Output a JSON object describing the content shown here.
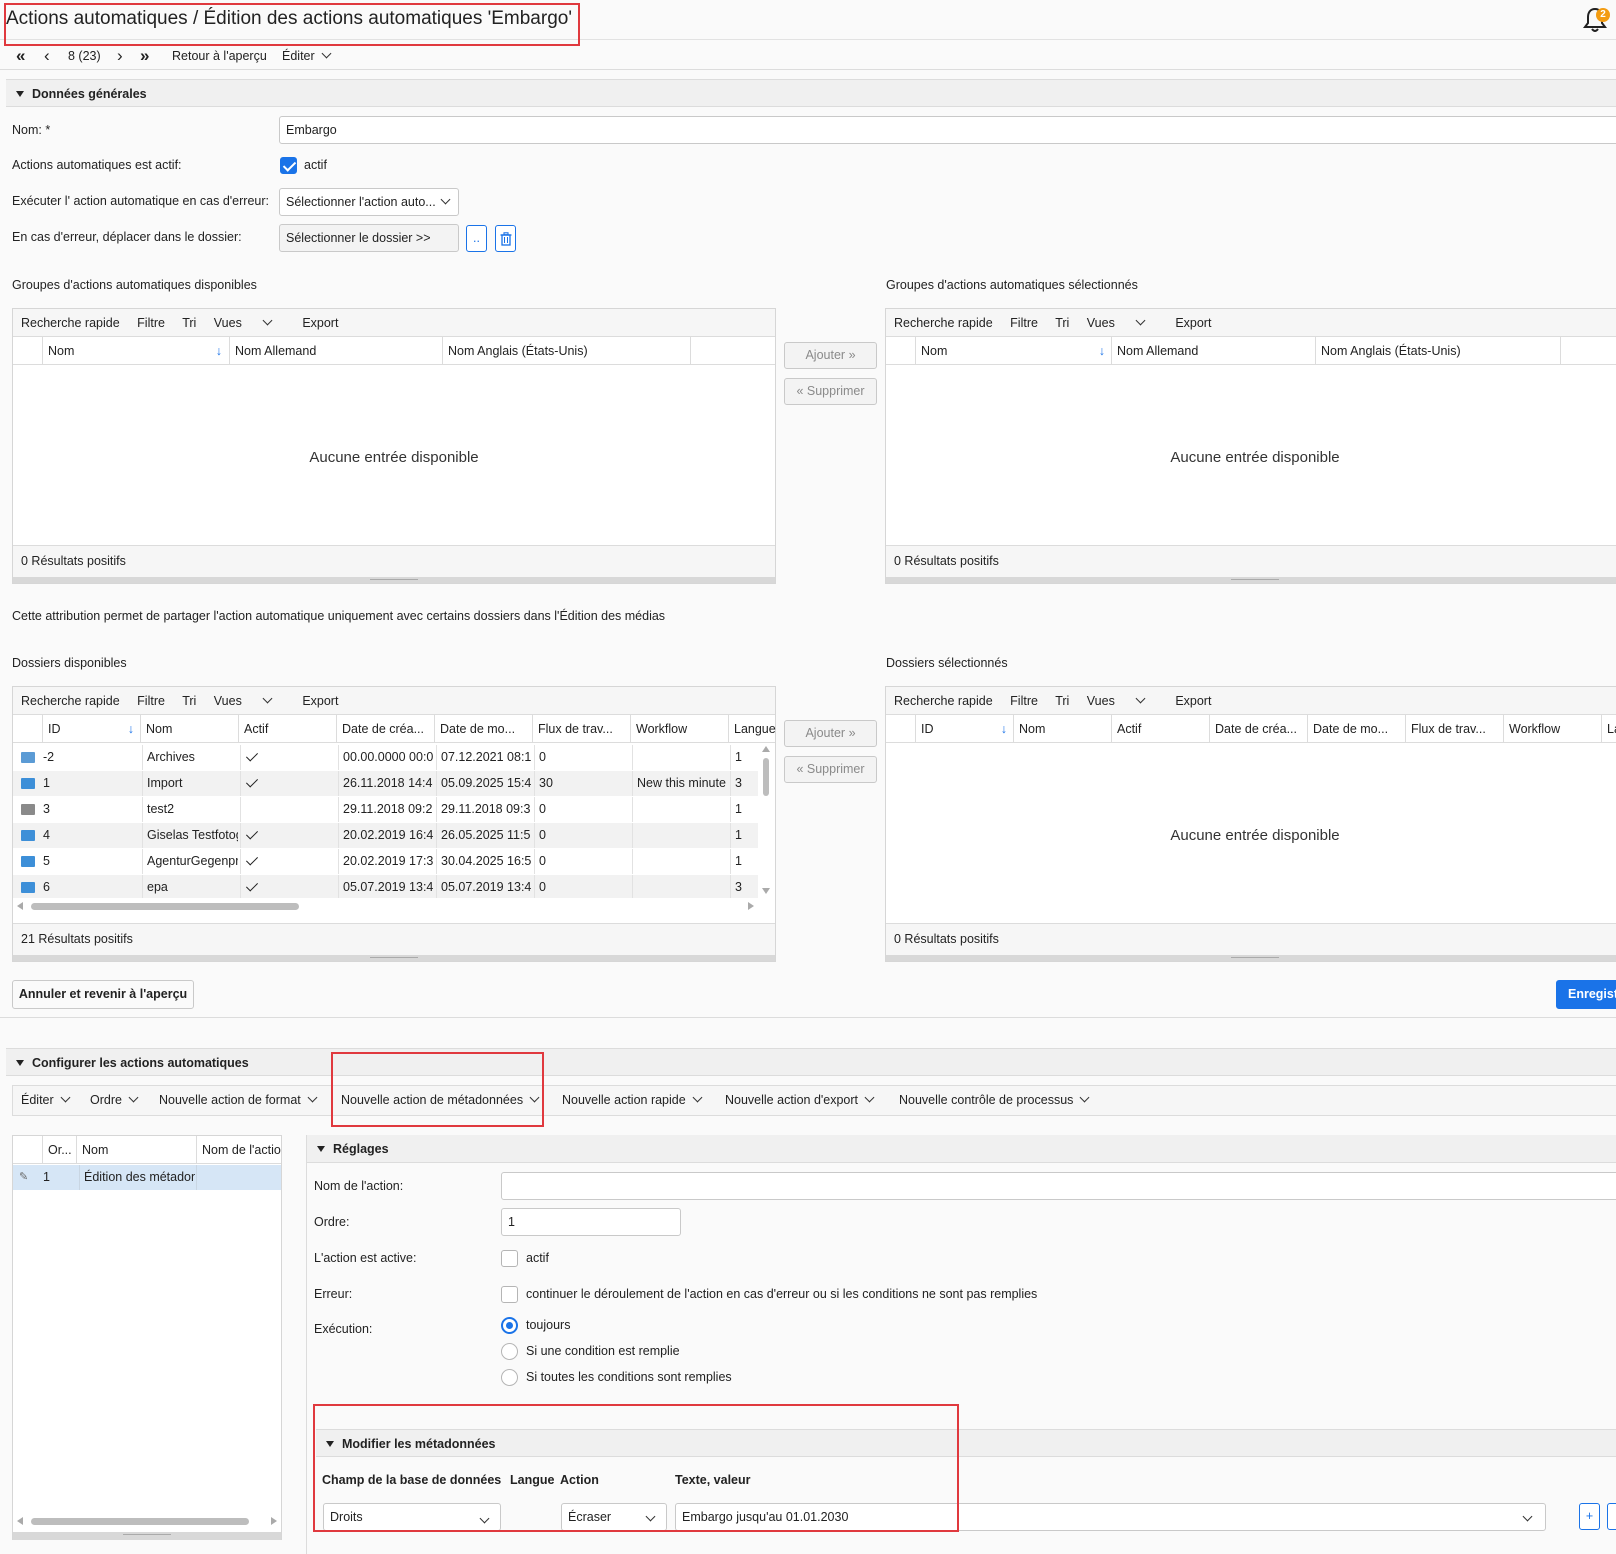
{
  "header": {
    "title": "Actions automatiques / Édition des actions automatiques 'Embargo'",
    "notification_count": "2"
  },
  "nav": {
    "position": "8 (23)",
    "back": "Retour à l'aperçu",
    "edit": "Éditer"
  },
  "general": {
    "section_title": "Données générales",
    "name_label": "Nom:",
    "name_required": "*",
    "name_value": "Embargo",
    "active_label": "Actions automatiques est actif:",
    "active_text": "actif",
    "active_checked": true,
    "on_error_label": "Exécuter l' action automatique en cas d'erreur:",
    "on_error_select": "Sélectionner l'action auto...",
    "move_folder_label": "En cas d'erreur, déplacer dans le dossier:",
    "move_folder_button": "Sélectionner le dossier >>",
    "dots_button": ".."
  },
  "common": {
    "toolbar": [
      "Recherche rapide",
      "Filtre",
      "Tri"
    ],
    "views": "Vues",
    "export": "Export",
    "add": "Ajouter",
    "remove": "Supprimer",
    "empty": "Aucune entrée disponible"
  },
  "groups": {
    "available_title": "Groupes d'actions automatiques disponibles",
    "selected_title": "Groupes d'actions automatiques sélectionnés",
    "columns": [
      "Nom",
      "Nom Allemand",
      "Nom Anglais (États-Unis)"
    ],
    "available_results": "0 Résultats positifs",
    "selected_results": "0 Résultats positifs"
  },
  "folders": {
    "info": "Cette attribution permet de partager l'action automatique uniquement avec certains dossiers dans l'Édition des médias",
    "available_title": "Dossiers disponibles",
    "selected_title": "Dossiers sélectionnés",
    "columns": [
      "ID",
      "Nom",
      "Actif",
      "Date de créa...",
      "Date de mo...",
      "Flux de trav...",
      "Workflow",
      "Langue"
    ],
    "selected_last_col": "La",
    "rows": [
      {
        "id": "-2",
        "name": "Archives",
        "active": true,
        "created": "00.00.0000 00:0",
        "modified": "07.12.2021 08:1",
        "flow": "0",
        "workflow": "",
        "lang": "1",
        "icon_color": "#5b9bd5"
      },
      {
        "id": "1",
        "name": "Import",
        "active": true,
        "created": "26.11.2018 14:4",
        "modified": "05.09.2025 15:4",
        "flow": "30",
        "workflow": "New this minute",
        "lang": "3",
        "icon_color": "#3d8fd8"
      },
      {
        "id": "3",
        "name": "test2",
        "active": false,
        "created": "29.11.2018 09:2",
        "modified": "29.11.2018 09:3",
        "flow": "0",
        "workflow": "",
        "lang": "1",
        "icon_color": "#8a8a8a"
      },
      {
        "id": "4",
        "name": "Giselas Testfotog",
        "active": true,
        "created": "20.02.2019 16:4",
        "modified": "26.05.2025 11:5",
        "flow": "0",
        "workflow": "",
        "lang": "1",
        "icon_color": "#3d8fd8"
      },
      {
        "id": "5",
        "name": "AgenturGegenpr",
        "active": true,
        "created": "20.02.2019 17:3",
        "modified": "30.04.2025 16:5",
        "flow": "0",
        "workflow": "",
        "lang": "1",
        "icon_color": "#3d8fd8"
      },
      {
        "id": "6",
        "name": "epa",
        "active": true,
        "created": "05.07.2019 13:4",
        "modified": "05.07.2019 13:4",
        "flow": "0",
        "workflow": "",
        "lang": "3",
        "icon_color": "#3d8fd8"
      }
    ],
    "available_results": "21 Résultats positifs",
    "selected_results": "0 Résultats positifs"
  },
  "actions": {
    "cancel": "Annuler et revenir à l'aperçu",
    "save": "Enregist"
  },
  "configure": {
    "section_title": "Configurer les actions automatiques",
    "menu": [
      "Éditer",
      "Ordre",
      "Nouvelle action de format",
      "Nouvelle action de métadonnées",
      "Nouvelle action rapide",
      "Nouvelle action d'export",
      "Nouvelle contrôle de processus"
    ],
    "list_columns": [
      "Or...",
      "Nom",
      "Nom de l'actio"
    ],
    "list_rows": [
      {
        "order": "1",
        "name": "Édition des métadon",
        "action_name": ""
      }
    ]
  },
  "settings": {
    "title": "Réglages",
    "action_name_label": "Nom de l'action:",
    "action_name_value": "",
    "order_label": "Ordre:",
    "order_value": "1",
    "active_label": "L'action est active:",
    "active_text": "actif",
    "error_label": "Erreur:",
    "error_text": "continuer le déroulement de l'action en cas d'erreur ou si les conditions ne sont pas remplies",
    "execution_label": "Exécution:",
    "execution_options": [
      "toujours",
      "Si une condition est remplie",
      "Si toutes les conditions sont remplies"
    ],
    "execution_selected": 0
  },
  "metadata": {
    "title": "Modifier les métadonnées",
    "columns": [
      "Champ de la base de données",
      "Langue",
      "Action",
      "Texte, valeur"
    ],
    "field": "Droits",
    "action": "Écraser",
    "value": "Embargo jusqu'au 01.01.2030",
    "plus": "+"
  },
  "colors": {
    "accent": "#1a73e8",
    "highlight_box": "#e0393e",
    "badge": "#f39c12"
  }
}
